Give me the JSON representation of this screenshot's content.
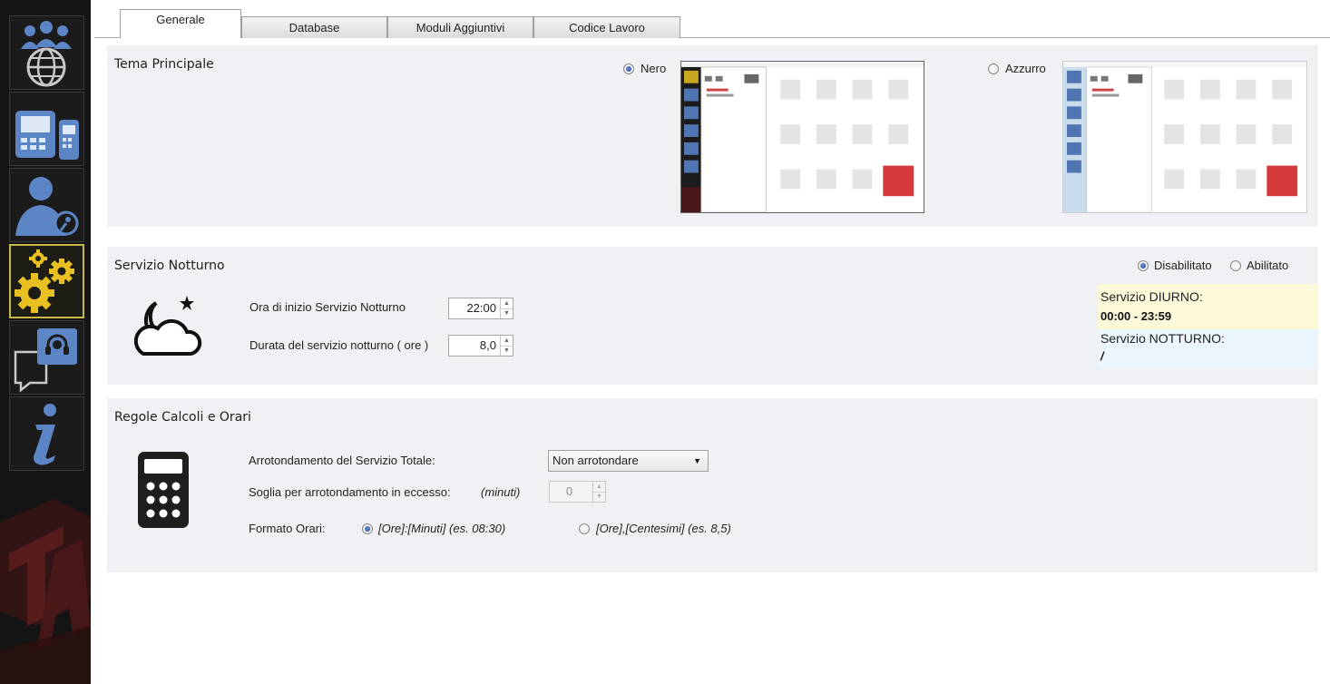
{
  "tabs": [
    {
      "label": "Generale",
      "active": true
    },
    {
      "label": "Database",
      "active": false
    },
    {
      "label": "Moduli Aggiuntivi",
      "active": false
    },
    {
      "label": "Codice Lavoro",
      "active": false
    }
  ],
  "sidebar": {
    "items": [
      {
        "icon": "users-globe-icon",
        "active": false
      },
      {
        "icon": "terminal-devices-icon",
        "active": false
      },
      {
        "icon": "user-key-icon",
        "active": false
      },
      {
        "icon": "gears-icon",
        "active": true
      },
      {
        "icon": "support-headset-icon",
        "active": false
      },
      {
        "icon": "info-icon",
        "active": false
      }
    ],
    "accent": "#c8b84a"
  },
  "theme": {
    "title": "Tema Principale",
    "options": [
      {
        "label": "Nero",
        "selected": true
      },
      {
        "label": "Azzurro",
        "selected": false
      }
    ]
  },
  "night_service": {
    "title": "Servizio Notturno",
    "mode_options": [
      {
        "label": "Disabilitato",
        "selected": true
      },
      {
        "label": "Abilitato",
        "selected": false
      }
    ],
    "start_label": "Ora di inizio Servizio Notturno",
    "start_value": "22:00",
    "duration_label": "Durata del servizio notturno ( ore )",
    "duration_value": "8,0",
    "day_label": "Servizio DIURNO:",
    "day_value": "00:00 - 23:59",
    "night_label": "Servizio NOTTURNO:",
    "night_value": "/"
  },
  "rules": {
    "title": "Regole Calcoli e Orari",
    "rounding_label": "Arrotondamento del Servizio Totale:",
    "rounding_value": "Non arrotondare",
    "threshold_label": "Soglia per arrotondamento in eccesso:",
    "threshold_unit": "(minuti)",
    "threshold_value": "0",
    "format_label": "Formato Orari:",
    "format_options": [
      {
        "label": "[Ore]:[Minuti] (es. 08:30)",
        "selected": true
      },
      {
        "label": "[Ore],[Centesimi] (es. 8,5)",
        "selected": false
      }
    ]
  }
}
